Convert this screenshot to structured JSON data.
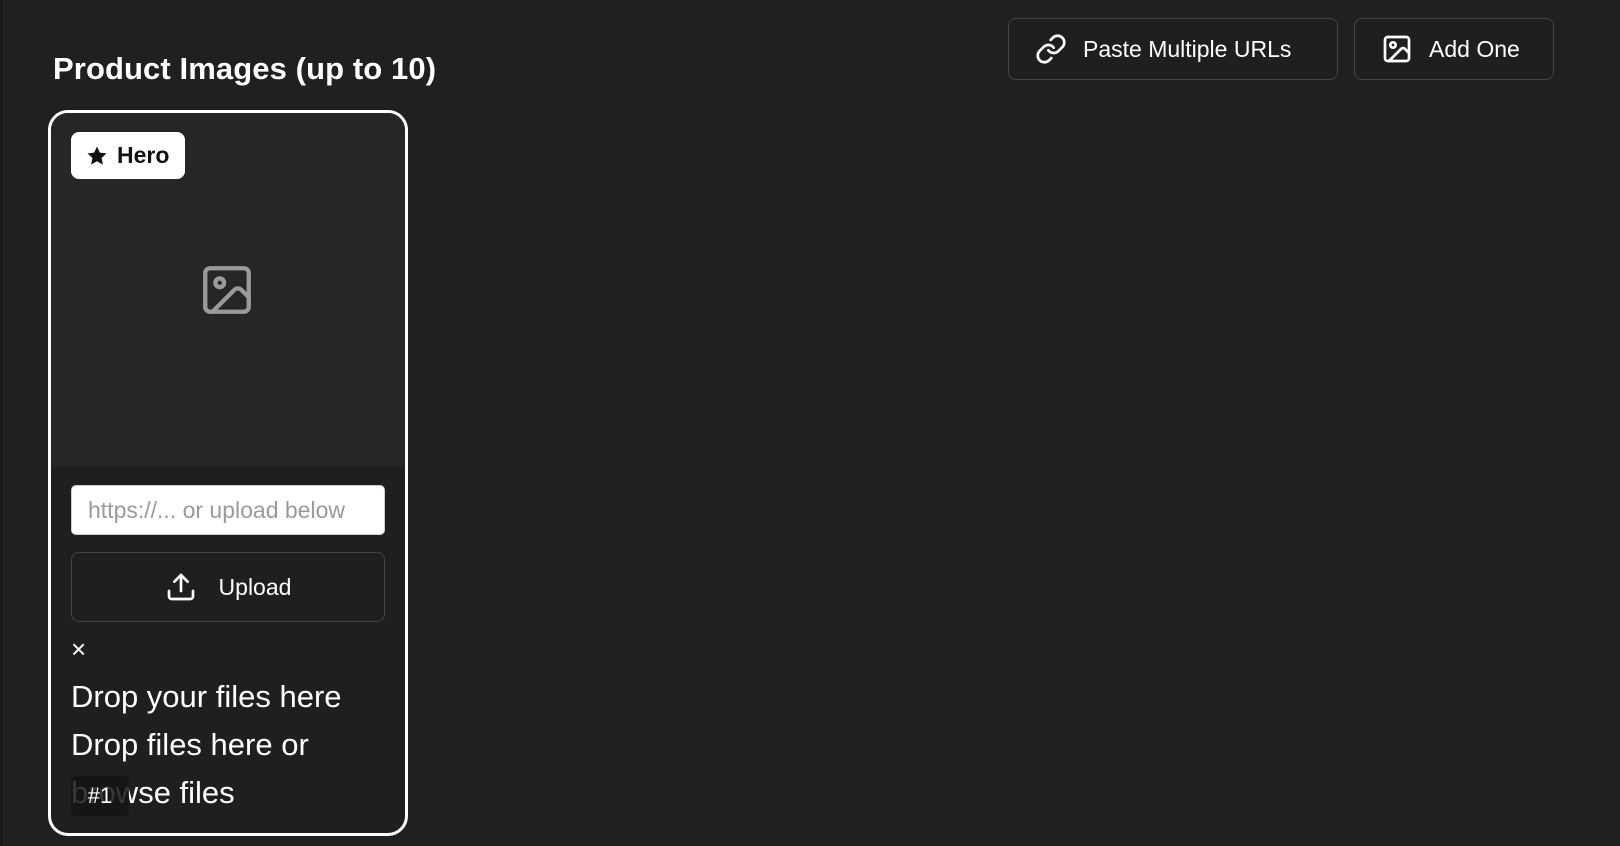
{
  "header": {
    "title": "Product Images (up to 10)",
    "paste_urls_label": "Paste Multiple URLs",
    "add_one_label": "Add One"
  },
  "image_card": {
    "hero_label": "Hero",
    "url_placeholder": "https://... or upload below",
    "upload_label": "Upload",
    "close_symbol": "×",
    "drop_title": "Drop your files here",
    "drop_line_1": "Drop files here or",
    "drop_line_2": "browse files",
    "index_label": "#1"
  },
  "icons": {
    "paste": "link-icon",
    "add": "image-icon",
    "hero": "star-icon",
    "placeholder": "image-icon",
    "upload": "upload-icon"
  }
}
